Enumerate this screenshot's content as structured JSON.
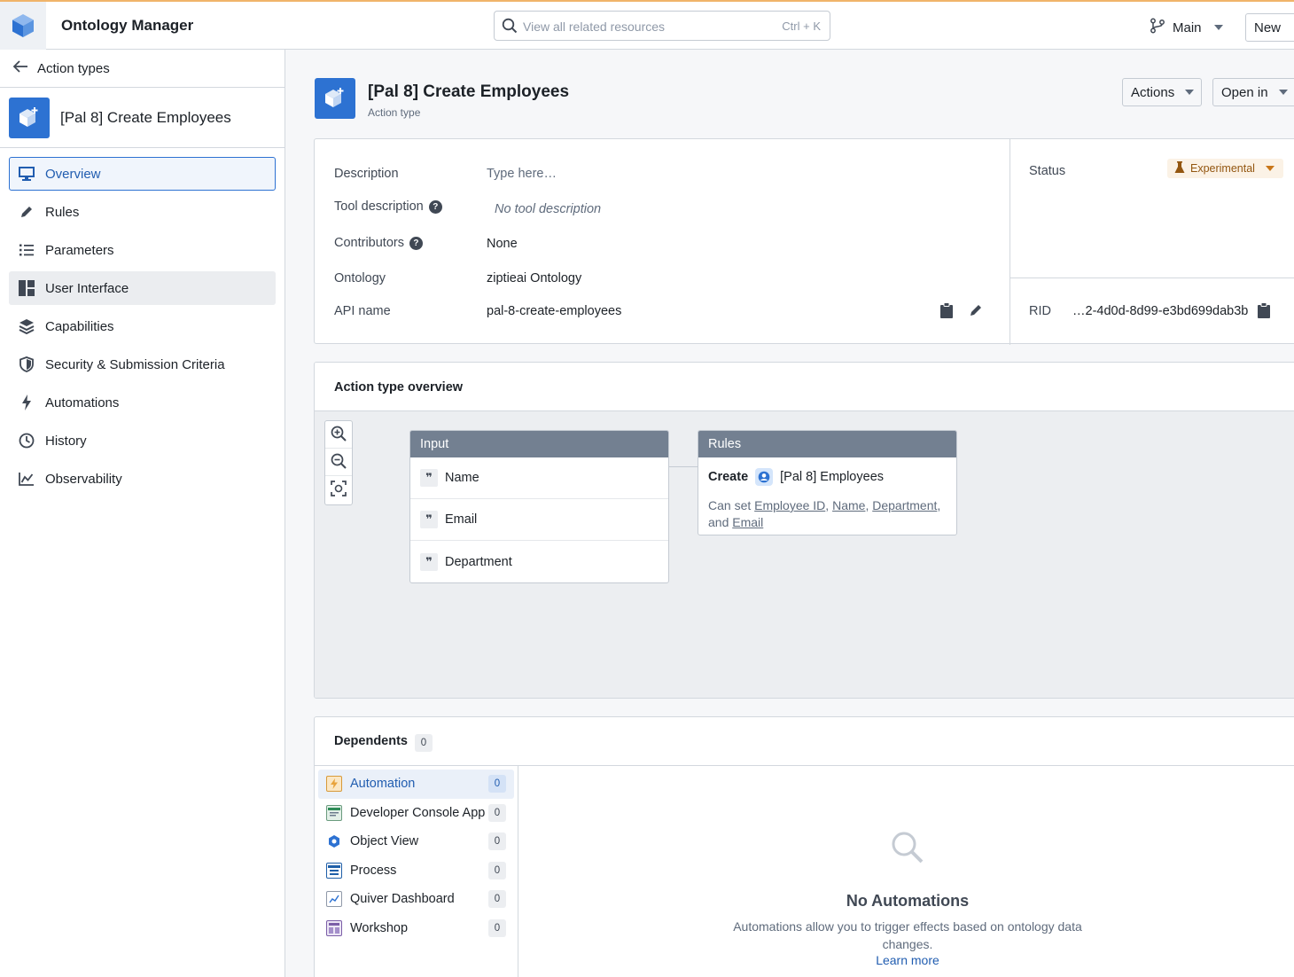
{
  "app": {
    "title": "Ontology Manager"
  },
  "search": {
    "placeholder": "View all related resources",
    "shortcut": "Ctrl + K"
  },
  "branch": {
    "label": "Main"
  },
  "new_button": {
    "label": "New"
  },
  "sidebar": {
    "back_label": "Action types",
    "resource_title": "[Pal 8] Create Employees",
    "items": [
      {
        "label": "Overview",
        "icon": "monitor-icon"
      },
      {
        "label": "Rules",
        "icon": "pencil-icon"
      },
      {
        "label": "Parameters",
        "icon": "list-icon"
      },
      {
        "label": "User Interface",
        "icon": "layout-icon"
      },
      {
        "label": "Capabilities",
        "icon": "layers-icon"
      },
      {
        "label": "Security & Submission Criteria",
        "icon": "shield-icon"
      },
      {
        "label": "Automations",
        "icon": "lightning-icon"
      },
      {
        "label": "History",
        "icon": "clock-icon"
      },
      {
        "label": "Observability",
        "icon": "chart-icon"
      }
    ]
  },
  "header": {
    "title": "[Pal 8] Create Employees",
    "subtitle": "Action type",
    "actions_label": "Actions",
    "open_in_label": "Open in"
  },
  "properties": {
    "description_label": "Description",
    "description_placeholder": "Type here…",
    "tool_description_label": "Tool description",
    "tool_description_value": "No tool description",
    "contributors_label": "Contributors",
    "contributors_value": "None",
    "ontology_label": "Ontology",
    "ontology_value": "ziptieai Ontology",
    "api_name_label": "API name",
    "api_name_value": "pal-8-create-employees",
    "status_label": "Status",
    "status_value": "Experimental",
    "rid_label": "RID",
    "rid_value": "…2-4d0d-8d99-e3bd699dab3b"
  },
  "overview": {
    "title": "Action type overview",
    "input_title": "Input",
    "inputs": [
      "Name",
      "Email",
      "Department"
    ],
    "rules_title": "Rules",
    "rule_verb": "Create",
    "rule_object": "[Pal 8] Employees",
    "rule_can_set": "Can set",
    "rule_fields": [
      "Employee ID",
      "Name",
      "Department"
    ],
    "rule_and": "and",
    "rule_last_field": "Email"
  },
  "dependents": {
    "title": "Dependents",
    "count": "0",
    "items": [
      {
        "label": "Automation",
        "count": "0",
        "icon": "automation-icon",
        "color": "#e8a33c"
      },
      {
        "label": "Developer Console App",
        "count": "0",
        "icon": "developer-console-icon",
        "color": "#2e8b57"
      },
      {
        "label": "Object View",
        "count": "0",
        "icon": "object-view-icon",
        "color": "#2d72d2"
      },
      {
        "label": "Process",
        "count": "0",
        "icon": "process-icon",
        "color": "#1f5fa8"
      },
      {
        "label": "Quiver Dashboard",
        "count": "0",
        "icon": "quiver-icon",
        "color": "#6b7a8c"
      },
      {
        "label": "Workshop",
        "count": "0",
        "icon": "workshop-icon",
        "color": "#7b5ea7"
      }
    ],
    "empty_title": "No Automations",
    "empty_desc": "Automations allow you to trigger effects based on ontology data changes.",
    "empty_link": "Learn more"
  }
}
